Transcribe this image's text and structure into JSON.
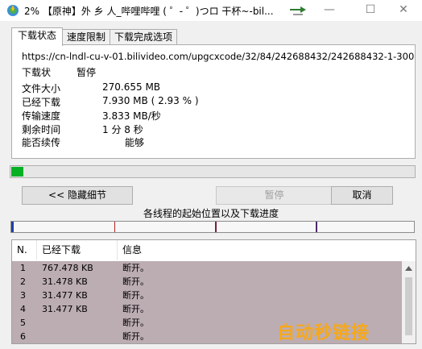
{
  "window": {
    "title": "2%  【原神】外 乡 人_哔哩哔哩 ( ゜- ゜)つロ 干杯~-bil...",
    "minimize": "—",
    "maximize": "☐",
    "close": "✕"
  },
  "tabs": [
    {
      "label": "下载状态"
    },
    {
      "label": "速度限制"
    },
    {
      "label": "下载完成选项"
    }
  ],
  "status": {
    "url": "https://cn-lndl-cu-v-01.bilivideo.com/upgcxcode/32/84/242688432/242688432-1-300",
    "state_label": "下载状",
    "state_value": "暂停",
    "file_size_label": "文件大小",
    "file_size_value": "270.655  MB",
    "downloaded_label": "已经下载",
    "downloaded_value": "7.930  MB  ( 2.93 % )",
    "speed_label": "传输速度",
    "speed_value": "3.833  MB/秒",
    "remaining_label": "剩余时间",
    "remaining_value": "1 分 8 秒",
    "resume_label": "能否续传",
    "resume_value": "能够"
  },
  "progress_fraction": 0.0293,
  "buttons": {
    "hide_details": "<< 隐藏细节",
    "pause": "暂停",
    "cancel": "取消"
  },
  "thread_label": "各线程的起始位置以及下载进度",
  "list": {
    "headers": {
      "n": "N.",
      "downloaded": "已经下载",
      "info": "信息"
    },
    "rows": [
      {
        "n": "1",
        "downloaded": "767.478  KB",
        "info": "断开。"
      },
      {
        "n": "2",
        "downloaded": "31.478  KB",
        "info": "断开。"
      },
      {
        "n": "3",
        "downloaded": "31.477  KB",
        "info": "断开。"
      },
      {
        "n": "4",
        "downloaded": "31.477  KB",
        "info": "断开。"
      },
      {
        "n": "5",
        "downloaded": "",
        "info": "断开。"
      },
      {
        "n": "6",
        "downloaded": "",
        "info": "断开。"
      }
    ]
  },
  "watermark": "自动秒链接",
  "colors": {
    "progress": "#06b025",
    "list_bg": "#bcadb3",
    "thread_marker": "#b22222"
  }
}
